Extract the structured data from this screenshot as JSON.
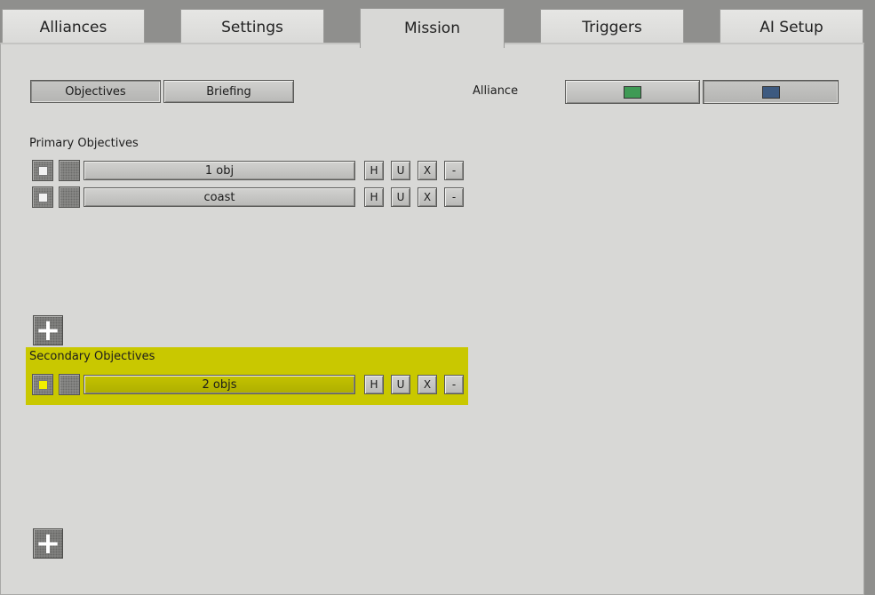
{
  "tabs": [
    "Alliances",
    "Settings",
    "Mission",
    "Triggers",
    "AI Setup"
  ],
  "active_tab": "Mission",
  "subtabs": {
    "objectives": "Objectives",
    "briefing": "Briefing"
  },
  "alliance": {
    "label": "Alliance",
    "colors": [
      "#3f9a55",
      "#3d5a80"
    ]
  },
  "primary": {
    "heading": "Primary Objectives",
    "items": [
      {
        "name": "1 obj",
        "checkbox_color": "#f2f2f2"
      },
      {
        "name": "coast",
        "checkbox_color": "#f2f2f2"
      }
    ]
  },
  "secondary": {
    "heading": "Secondary Objectives",
    "items": [
      {
        "name": "2 objs",
        "checkbox_color": "#f2f000"
      }
    ],
    "highlight_color": "#c9c800"
  },
  "row_buttons": {
    "h": "H",
    "u": "U",
    "x": "X",
    "minus": "-"
  },
  "add_symbol": "+"
}
